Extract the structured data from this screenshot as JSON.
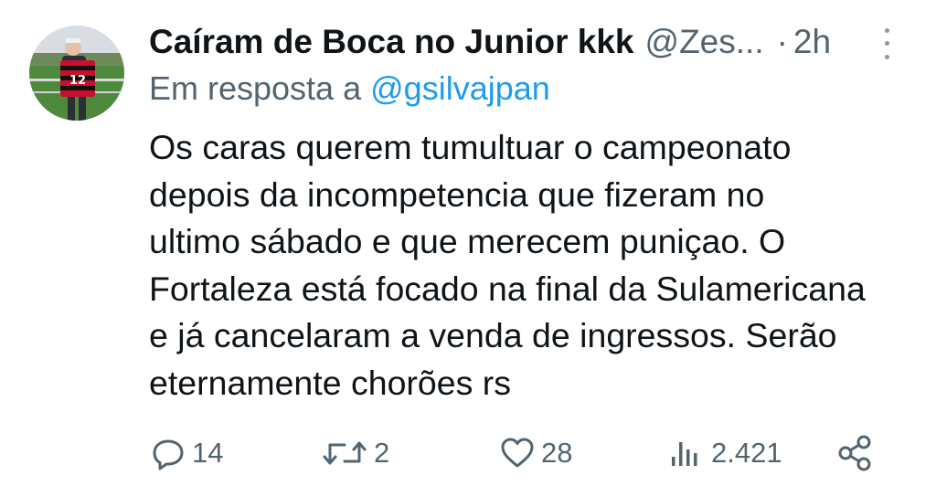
{
  "tweet": {
    "display_name": "Caíram de Boca no Junior kkk",
    "handle": "@Zes...",
    "separator": "·",
    "time": "2h",
    "reply_prefix": "Em resposta a",
    "reply_to": "@gsilvajpan",
    "body_lines": [
      "Os caras querem tumultuar o campeonato",
      "depois da incompetencia que fizeram no",
      "ultimo sábado e que merecem puniçao. O",
      "Fortaleza está focado na final da Sulamericana",
      "e já cancelaram a venda de ingressos. Serão",
      "eternamente chorões rs"
    ],
    "avatar_jersey_number": "12"
  },
  "actions": {
    "replies": "14",
    "retweets": "2",
    "likes": "28",
    "views": "2.421"
  },
  "icons": {
    "reply": "reply-icon",
    "retweet": "retweet-icon",
    "like": "heart-icon",
    "views": "views-icon",
    "share": "share-icon",
    "more": "more-icon"
  },
  "colors": {
    "text": "#0f1419",
    "muted": "#536471",
    "link": "#1d9bf0"
  }
}
